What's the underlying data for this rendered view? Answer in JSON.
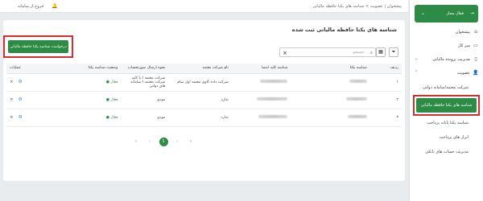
{
  "topbar": {
    "breadcrumb": "پیشخوان | عضویت > شناسه های یکتا حافظه مالیاتی",
    "exit_label": "خروج از سامانه"
  },
  "sidebar": {
    "status_label": "فعال مجاز",
    "items": [
      {
        "label": "پیشخوان",
        "icon": "home-icon"
      },
      {
        "label": "میز کار",
        "icon": "desk-icon"
      },
      {
        "label": "مدیریت پرونده مالیاتی",
        "icon": "file-icon"
      },
      {
        "label": "عضویت",
        "icon": "user-icon"
      }
    ],
    "subitems": [
      {
        "label": "شرکت معتمد/سامانه دولتی"
      },
      {
        "label": "شناسه های یکتا حافظه مالیاتی"
      },
      {
        "label": "شناسه یکتا پایانه پرداخت"
      },
      {
        "label": "ابزار های پرداخت"
      },
      {
        "label": "مدیریت حساب های بانکی"
      }
    ]
  },
  "main": {
    "title": "شناسه های یکتا حافظه مالیاتی ثبت شده",
    "request_button": "درخواست شناسه یکتا حافظه مالیاتی",
    "search_placeholder": "جستجو",
    "columns": [
      "ردیف",
      "شناسه یکتا",
      "شناسه کلید امضا",
      "نام شرکت معتمد",
      "نحوه ارسال صورتحساب",
      "وضعیت شناسه یکتا",
      "عملیات"
    ],
    "rows": [
      {
        "index": "۱",
        "company": "شرکت داده کاوی معتمد اول سام",
        "method": "شرکت معتمد / با کلید شرکت معتمد / سامانه های دولتی",
        "status": "فعال"
      },
      {
        "index": "۲",
        "company": "ندارد",
        "method": "مودی",
        "status": "فعال"
      },
      {
        "index": "۳",
        "company": "ندارد",
        "method": "مودی",
        "status": "فعال"
      }
    ],
    "pagination": {
      "current": "1"
    }
  },
  "colors": {
    "accent": "#2e8b45",
    "highlight": "#d32f2f"
  }
}
